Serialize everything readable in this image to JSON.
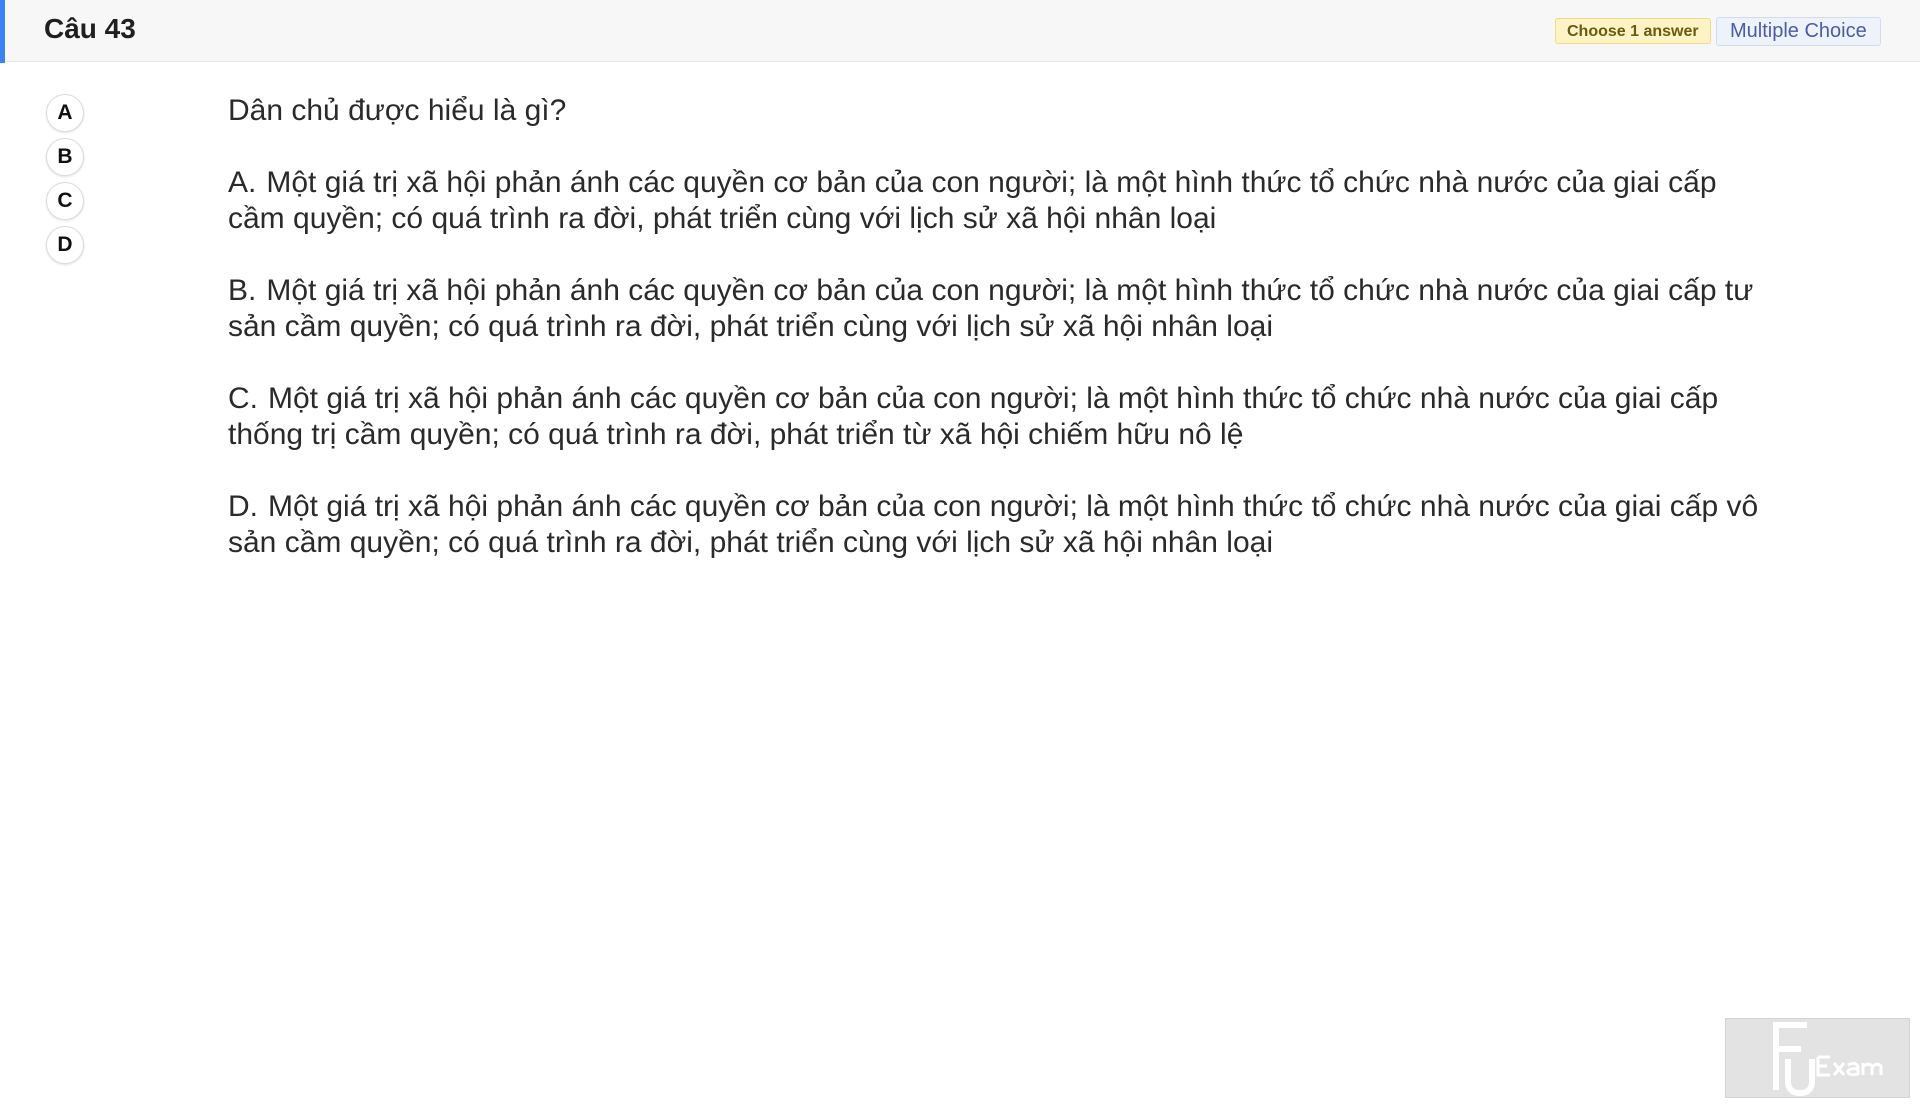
{
  "header": {
    "title": "Câu 43",
    "badge_choose": "Choose 1 answer",
    "badge_type": "Multiple Choice",
    "accent_color": "#3b82f6"
  },
  "options": [
    "A",
    "B",
    "C",
    "D"
  ],
  "question": {
    "stem": "Dân chủ được hiểu là gì?",
    "answers": [
      {
        "letter": "A.",
        "text": "Một giá trị xã hội phản ánh các quyền cơ bản của con người; là một hình thức tổ chức nhà nước của giai cấp cầm quyền; có quá trình ra đời, phát triển cùng với lịch sử xã hội nhân loại"
      },
      {
        "letter": "B.",
        "text": "Một giá trị xã hội phản ánh các quyền cơ bản của con người; là một hình thức tổ chức nhà nước của giai cấp tư sản cầm quyền; có quá trình ra đời, phát triển cùng với lịch sử xã hội nhân loại"
      },
      {
        "letter": "C.",
        "text": "Một giá trị xã hội phản ánh các quyền cơ bản của con người; là một hình thức tổ chức nhà nước của giai cấp thống trị cầm quyền; có quá trình ra đời, phát triển từ xã hội chiếm hữu nô lệ"
      },
      {
        "letter": "D.",
        "text": "Một giá trị xã hội phản ánh các quyền cơ bản của con người; là một hình thức tổ chức nhà nước của giai cấp vô sản cầm quyền; có quá trình ra đời, phát triển cùng với lịch sử xã hội nhân loại"
      }
    ]
  },
  "logo": {
    "text": "FU Exam"
  }
}
